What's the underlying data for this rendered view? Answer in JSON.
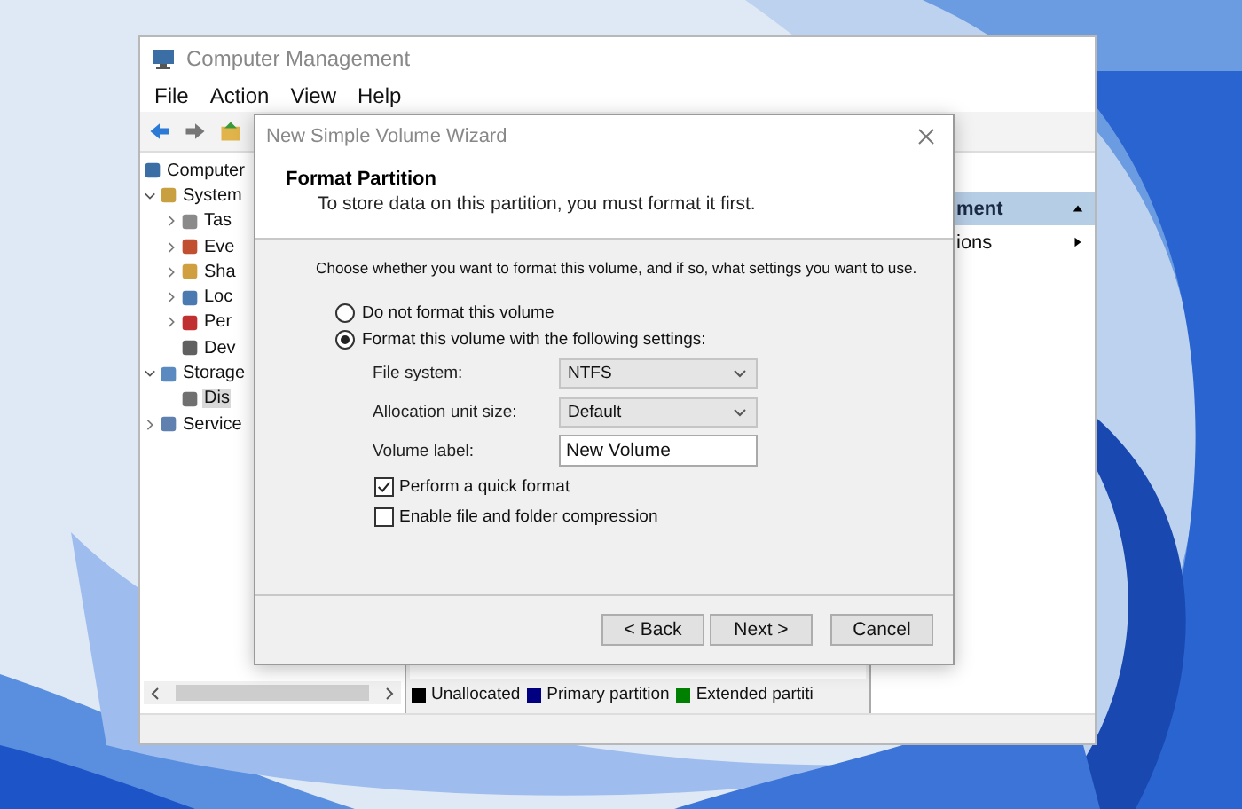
{
  "window": {
    "title": "Computer Management",
    "menu": [
      "File",
      "Action",
      "View",
      "Help"
    ]
  },
  "tree": [
    {
      "label": "Computer",
      "kind": "root",
      "selected": false,
      "children": [
        {
          "label": "System",
          "kind": "branch",
          "expanded": true,
          "selected": false,
          "children": [
            {
              "label": "Tas",
              "kind": "branch",
              "expanded": false,
              "selected": false
            },
            {
              "label": "Eve",
              "kind": "branch",
              "expanded": false,
              "selected": false
            },
            {
              "label": "Sha",
              "kind": "branch",
              "expanded": false,
              "selected": false
            },
            {
              "label": "Loc",
              "kind": "branch",
              "expanded": false,
              "selected": false
            },
            {
              "label": "Per",
              "kind": "branch",
              "expanded": false,
              "selected": false
            },
            {
              "label": "Dev",
              "kind": "leaf",
              "selected": false
            }
          ]
        },
        {
          "label": "Storage",
          "kind": "branch",
          "expanded": true,
          "selected": false,
          "children": [
            {
              "label": "Dis",
              "kind": "leaf",
              "selected": true
            }
          ]
        },
        {
          "label": "Service",
          "kind": "branch",
          "expanded": false,
          "selected": false
        }
      ]
    }
  ],
  "legend": [
    {
      "label": "Unallocated",
      "color": "#000000"
    },
    {
      "label": "Primary partition",
      "color": "#000080"
    },
    {
      "label": "Extended partiti",
      "color": "#008000"
    }
  ],
  "actions": [
    {
      "label": "ment",
      "kind": "header"
    },
    {
      "label": "ions",
      "kind": "item"
    }
  ],
  "dialog": {
    "title": "New Simple Volume Wizard",
    "heading": "Format Partition",
    "subtitle": "To store data on this partition, you must format it first.",
    "instruction": "Choose whether you want to format this volume, and if so, what settings you want to use.",
    "options": [
      {
        "label": "Do not format this volume",
        "selected": false
      },
      {
        "label": "Format this volume with the following settings:",
        "selected": true
      }
    ],
    "fields": [
      {
        "label": "File system:",
        "kind": "select",
        "value": "NTFS"
      },
      {
        "label": "Allocation unit size:",
        "kind": "select",
        "value": "Default"
      },
      {
        "label": "Volume label:",
        "kind": "text",
        "value": "New Volume"
      }
    ],
    "checkboxes": [
      {
        "label": "Perform a quick format",
        "checked": true
      },
      {
        "label": "Enable file and folder compression",
        "checked": false
      }
    ],
    "buttons": [
      "< Back",
      "Next >",
      "Cancel"
    ]
  }
}
